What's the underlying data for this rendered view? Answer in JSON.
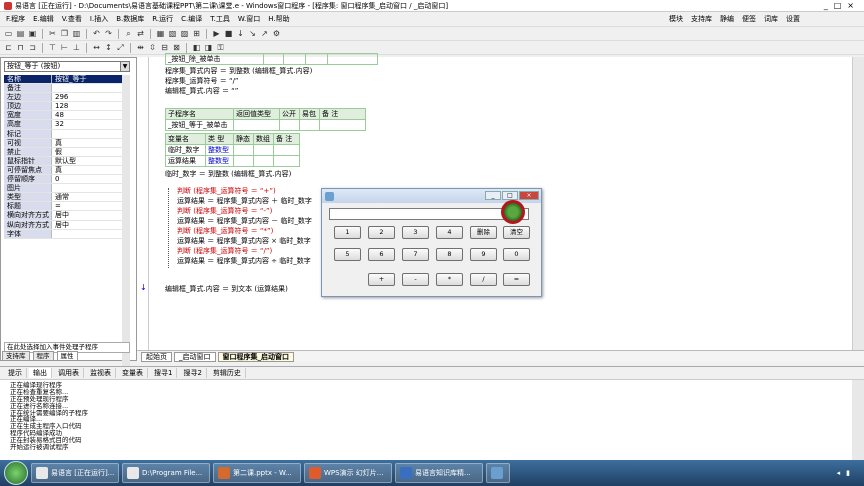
{
  "window": {
    "title": "易语言 [正在运行] - D:\\Documents\\易语言基础课程PPT\\第二课\\课堂.e - Windows窗口程序 - [程序集: 窗口程序集_启动窗口 / _启动窗口]",
    "controls": [
      "_",
      "□",
      "×"
    ]
  },
  "menu": {
    "items": [
      "F.程序",
      "E.编辑",
      "V.查看",
      "I.插入",
      "B.数据库",
      "R.运行",
      "C.编译",
      "T.工具",
      "W.窗口",
      "H.帮助"
    ],
    "right": [
      "模块",
      "支持库",
      "静编",
      "便签",
      "词库",
      "设置"
    ]
  },
  "left_panel": {
    "combo": "按钮_等于 (按钮)",
    "properties": [
      [
        "名称",
        "按钮_等于"
      ],
      [
        "备注",
        ""
      ],
      [
        "左边",
        "296"
      ],
      [
        "顶边",
        "128"
      ],
      [
        "宽度",
        "48"
      ],
      [
        "高度",
        "32"
      ],
      [
        "标记",
        ""
      ],
      [
        "可视",
        "真"
      ],
      [
        "禁止",
        "假"
      ],
      [
        "鼠标指针",
        "默认型"
      ],
      [
        "可停留焦点",
        "真"
      ],
      [
        "停留顺序",
        "0"
      ],
      [
        "图片",
        ""
      ],
      [
        "类型",
        "通常"
      ],
      [
        "标题",
        "="
      ],
      [
        "横向对齐方式",
        "居中"
      ],
      [
        "纵向对齐方式",
        "居中"
      ],
      [
        "字体",
        ""
      ]
    ],
    "hint": "在此处选择加入事件处理子程序",
    "tabs": [
      "支持库",
      "程序",
      "属性"
    ]
  },
  "editor": {
    "top_lines": [
      "_按钮_除_被单击",
      "程序集_算式内容 ＝ 到整数 (编辑框_算式.内容)",
      "程序集_运算符号 ＝ “/”",
      "编辑框_算式.内容 ＝ “”"
    ],
    "sub_header": [
      "子程序名",
      "返回值类型",
      "公开",
      "易包",
      "备 注"
    ],
    "sub_row": [
      "_按钮_等于_被单击",
      "",
      "",
      "",
      ""
    ],
    "var_header": [
      "变量名",
      "类 型",
      "静态",
      "数组",
      "备 注"
    ],
    "var_rows": [
      [
        "临时_数字",
        "整数型",
        "",
        "",
        ""
      ],
      [
        "运算结果",
        "整数型",
        "",
        "",
        ""
      ]
    ],
    "assign": "临时_数字 ＝ 到整数 (编辑框_算式.内容)",
    "code": [
      "判断 (程序集_运算符号 ＝ “+”)",
      "运算结果 ＝ 程序集_算式内容 ＋ 临时_数字",
      "判断 (程序集_运算符号 ＝ “-”)",
      "运算结果 ＝ 程序集_算式内容 － 临时_数字",
      "判断 (程序集_运算符号 ＝ “*”)",
      "运算结果 ＝ 程序集_算式内容 × 临时_数字",
      "判断 (程序集_运算符号 ＝ “/”)",
      "运算结果 ＝ 程序集_算式内容 ÷ 临时_数字",
      ""
    ],
    "last": "编辑框_算式.内容 ＝ 到文本 (运算结果)",
    "tabs": [
      "起始页",
      "_启动窗口",
      "窗口程序集_启动窗口"
    ]
  },
  "output": {
    "tabs": [
      "提示",
      "输出",
      "调用表",
      "监视表",
      "变量表",
      "搜寻1",
      "搜寻2",
      "剪辑历史"
    ],
    "lines": [
      "正在编译现行程序",
      "正在检查重复名称...",
      "正在预处理现行程序",
      "正在进行名称连接...",
      "正在统计需要编译的子程序",
      "正在编译...",
      "正在生成主程序入口代码",
      "程序代码编译成功",
      "正在封装易格式目的代码",
      "开始运行被调试程序"
    ]
  },
  "calculator": {
    "display": "",
    "buttons": [
      "1",
      "2",
      "3",
      "4",
      "删除",
      "清空",
      "5",
      "6",
      "7",
      "8",
      "9",
      "0",
      "+",
      "-",
      "*",
      "/",
      "="
    ]
  },
  "taskbar": {
    "tasks": [
      "易语言 [正在运行]...",
      "D:\\Program File...",
      "第二课.pptx - W...",
      "WPS演示 幻灯片...",
      "易语言知识库精...",
      ""
    ],
    "clock": "",
    "colors": {
      "accent": "#1f3f63"
    }
  }
}
